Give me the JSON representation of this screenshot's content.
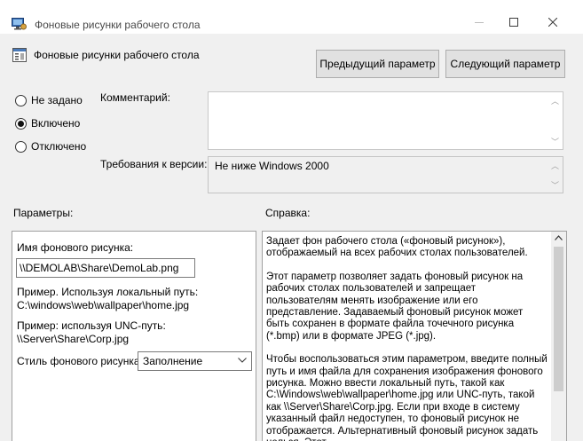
{
  "window": {
    "title": "Фоновые рисунки рабочего стола",
    "minimize": "—",
    "maximize": "☐",
    "close": "✕"
  },
  "policy": {
    "title": "Фоновые рисунки рабочего стола"
  },
  "nav": {
    "prev_label": "Предыдущий параметр",
    "next_label": "Следующий параметр"
  },
  "state": {
    "options": [
      {
        "label": "Не задано",
        "checked": false
      },
      {
        "label": "Включено",
        "checked": true
      },
      {
        "label": "Отключено",
        "checked": false
      }
    ]
  },
  "comment": {
    "label": "Комментарий:",
    "value": ""
  },
  "requirements": {
    "label": "Требования к версии:",
    "value": "Не ниже Windows 2000"
  },
  "sections": {
    "params_label": "Параметры:",
    "help_label": "Справка:"
  },
  "params": {
    "wallpaper_name_label": "Имя фонового рисунка:",
    "wallpaper_name_value": "\\\\DEMOLAB\\Share\\DemoLab.png",
    "example_local_1": "Пример. Используя локальный путь:",
    "example_local_2": "C:\\windows\\web\\wallpaper\\home.jpg",
    "example_unc_1": "Пример: используя UNC-путь:",
    "example_unc_2": "\\\\Server\\Share\\Corp.jpg",
    "style_label": "Стиль фонового рисунка:",
    "style_value": "Заполнение"
  },
  "help": {
    "paragraphs": [
      "Задает фон рабочего стола («фоновый рисунок»), отображаемый на всех рабочих столах пользователей.",
      "Этот параметр позволяет задать фоновый рисунок на рабочих столах пользователей и запрещает пользователям менять изображение или его представление. Задаваемый фоновый рисунок может быть сохранен в формате файла точечного рисунка (*.bmp) или в формате JPEG (*.jpg).",
      "Чтобы воспользоваться этим параметром, введите полный путь и имя файла для сохранения изображения фонового рисунка. Можно ввести локальный путь, такой как C:\\Windows\\web\\wallpaper\\home.jpg или UNC-путь, такой как \\\\Server\\Share\\Corp.jpg. Если при входе в систему указанный файл недоступен, то фоновый рисунок не отображается. Альтернативный фоновый рисунок задать нельзя. Этот"
    ]
  },
  "colors": {
    "window_bg": "#f0f0f0",
    "titlebar_bg": "#ffffff",
    "button_bg": "#e1e1e1",
    "border": "#adadad"
  }
}
